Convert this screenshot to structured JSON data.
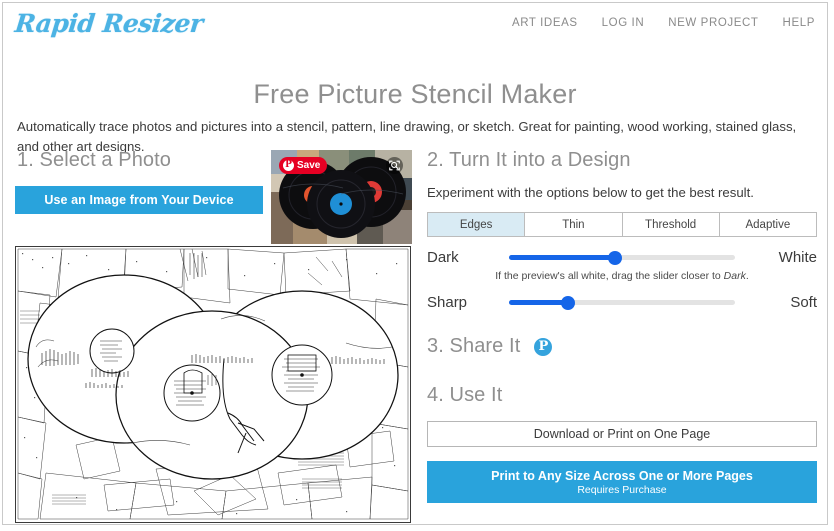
{
  "brand": {
    "logo_text": "Rapid Resizer",
    "logo_color": "#4cb3e4"
  },
  "nav": {
    "items": [
      {
        "label": "ART IDEAS"
      },
      {
        "label": "LOG IN"
      },
      {
        "label": "NEW PROJECT"
      },
      {
        "label": "HELP"
      }
    ]
  },
  "header": {
    "title": "Free Picture Stencil Maker",
    "intro": "Automatically trace photos and pictures into a stencil, pattern, line drawing, or sketch. Great for painting, wood working, stained glass, and other art designs."
  },
  "step1": {
    "heading": "1. Select a Photo",
    "use_image_label": "Use an Image from Your Device",
    "thumbnail": {
      "pin_save_label": "Save",
      "pin_glyph": "P",
      "expand_icon": "expand-icon",
      "subject": "three vinyl records on a pile of album covers"
    }
  },
  "preview": {
    "alt": "black and white line-drawing stencil of three vinyl records"
  },
  "step2": {
    "heading": "2. Turn It into a Design",
    "subtitle": "Experiment with the options below to get the best result.",
    "tabs": [
      {
        "label": "Edges",
        "active": true
      },
      {
        "label": "Thin",
        "active": false
      },
      {
        "label": "Threshold",
        "active": false
      },
      {
        "label": "Adaptive",
        "active": false
      }
    ],
    "sliders": [
      {
        "left_label": "Dark",
        "right_label": "White",
        "value": 47
      },
      {
        "left_label": "Sharp",
        "right_label": "Soft",
        "value": 26
      }
    ],
    "hint_before": "If the preview's all white, drag the slider closer to ",
    "hint_emphasis": "Dark",
    "hint_after": "."
  },
  "step3": {
    "heading": "3. Share It",
    "pinterest_glyph": "P"
  },
  "step4": {
    "heading": "4. Use It",
    "download_label": "Download or Print on One Page",
    "print_label": "Print to Any Size Across One or More Pages",
    "print_sublabel": "Requires Purchase"
  },
  "colors": {
    "accent_blue": "#29a3dc",
    "slider_blue": "#1565e8",
    "pinterest_red": "#e60023",
    "tab_active_bg": "#d9ebf4"
  }
}
